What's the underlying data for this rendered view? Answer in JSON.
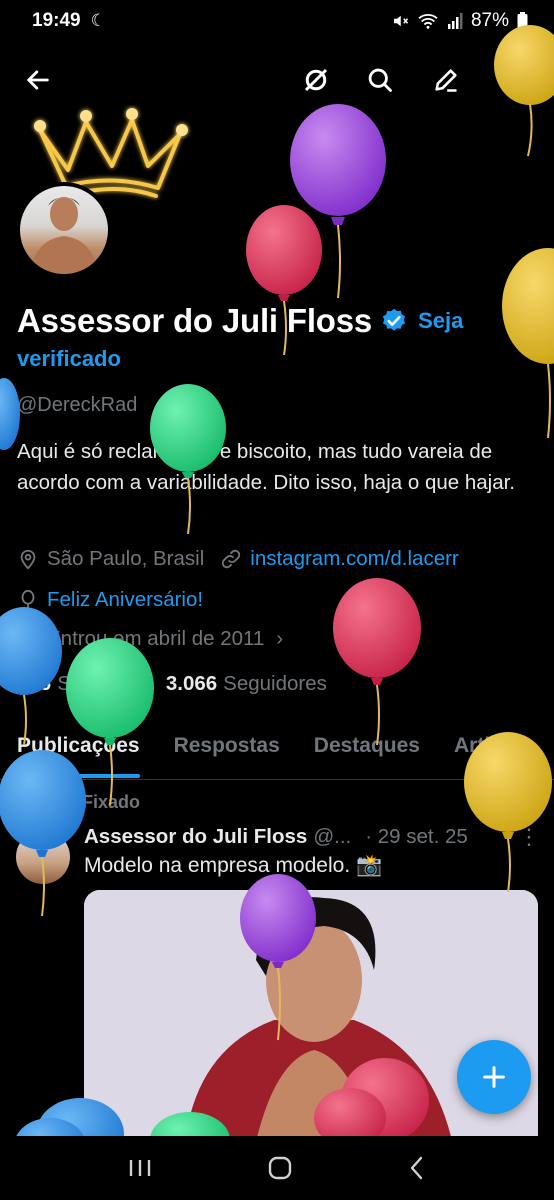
{
  "status": {
    "time": "19:49",
    "battery": "87%"
  },
  "profile": {
    "display_name": "Assessor do Juli Floss",
    "verify_cta_1": "Seja",
    "verify_cta_2": "verificado",
    "handle": "@DereckRad",
    "bio": "Aqui é só reclamação e biscoito, mas tudo vareia de acordo com a variabilidade. Dito isso, haja o que hajar.",
    "location": "São Paulo, Brasil",
    "website": "instagram.com/d.lacerr",
    "birthday": "Feliz Aniversário!",
    "joined": "Entrou em abril de 2011",
    "following_count": "606",
    "following_label": "Seguindo",
    "followers_count": "3.066",
    "followers_label": "Seguidores"
  },
  "tabs": [
    "Publicações",
    "Respostas",
    "Destaques",
    "Artigos"
  ],
  "pinned_post": {
    "pinned_label": "Fixado",
    "author": "Assessor do Juli Floss",
    "handle": "@...",
    "date": "· 29 set. 25",
    "text": "Modelo na empresa modelo. 📸"
  },
  "colors": {
    "accent": "#1d9bf0",
    "background": "#000000",
    "muted": "#71767b"
  },
  "icons": [
    "back-arrow-icon",
    "grok-icon",
    "search-icon",
    "edit-icon",
    "more-icon",
    "verified-badge-icon",
    "location-icon",
    "link-icon",
    "balloon-icon",
    "calendar-icon",
    "pin-icon",
    "plus-icon"
  ]
}
